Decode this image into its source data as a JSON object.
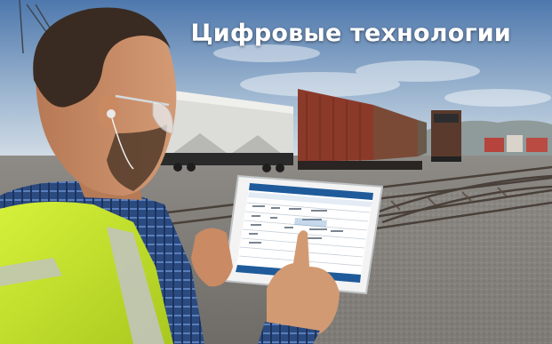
{
  "headline": "Цифровые технологии",
  "colors": {
    "sky_top": "#5f86b8",
    "sky_bottom": "#cfdbe6",
    "gravel": "#8d8a86",
    "hopper_car": "#d9d9d6",
    "boxcar": "#8e3b2b",
    "safety_vest": "#c9ec2e",
    "tablet_frame": "#f2f2f2",
    "app_header": "#1f5b9a",
    "shirt_plaid": "#2f4e86",
    "skin": "#c98d66"
  },
  "icons": [
    "safety-glasses-icon",
    "earphone-icon"
  ]
}
